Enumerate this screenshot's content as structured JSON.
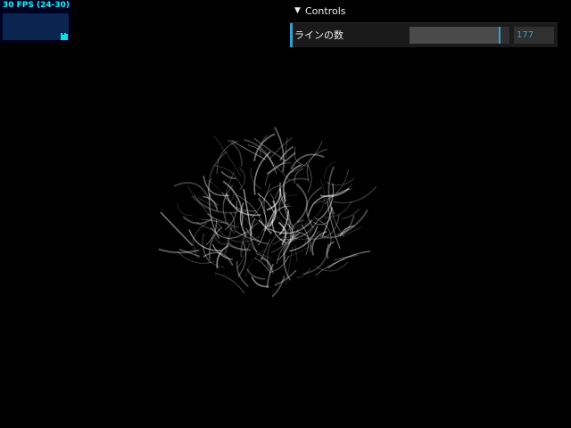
{
  "stats": {
    "fps_text": "30 FPS (24-30)"
  },
  "gui": {
    "title": "Controls",
    "chevron_icon": "chevron-down-icon",
    "line_count_label": "ラインの数",
    "line_count_value": "177",
    "line_count_slider_fraction": 0.9,
    "accent_color": "#2fa1d6"
  },
  "scene": {
    "background_color": "#000000",
    "axis_colors": {
      "x": "#ff3b3b",
      "y": "#7cdf2e",
      "x_tip": "#ffb24a"
    },
    "line_count": 177,
    "line_color": "#ffffff"
  }
}
